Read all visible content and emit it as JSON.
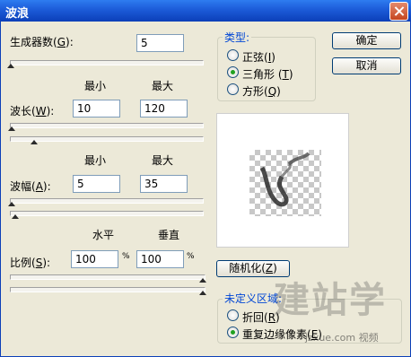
{
  "window": {
    "title": "波浪"
  },
  "generators": {
    "label": "生成器数",
    "hotkey": "G",
    "value": "5"
  },
  "wavelength": {
    "col_min": "最小",
    "col_max": "最大",
    "label": "波长",
    "hotkey": "W",
    "min_value": "10",
    "max_value": "120"
  },
  "amplitude": {
    "col_min": "最小",
    "col_max": "最大",
    "label": "波幅",
    "hotkey": "A",
    "min_value": "5",
    "max_value": "35"
  },
  "scale": {
    "col_h": "水平",
    "col_v": "垂直",
    "label": "比例",
    "hotkey": "S",
    "h_value": "100",
    "v_value": "100",
    "unit": "%"
  },
  "buttons": {
    "ok": "确定",
    "cancel": "取消",
    "randomize": "随机化",
    "randomize_hotkey": "Z"
  },
  "type_group": {
    "legend": "类型:",
    "options": [
      {
        "label": "正弦",
        "hotkey": "I",
        "selected": false
      },
      {
        "label": "三角形",
        "hotkey": "T",
        "selected": true
      },
      {
        "label": "方形",
        "hotkey": "Q",
        "selected": false
      }
    ]
  },
  "undefined_group": {
    "legend": "未定义区域:",
    "options": [
      {
        "label": "折回",
        "hotkey": "R",
        "selected": false
      },
      {
        "label": "重复边缘像素",
        "hotkey": "E",
        "selected": true
      }
    ]
  },
  "watermark": {
    "big": "建站学",
    "small": "jzxue.com 视频"
  },
  "colors": {
    "title_bar": "#1c5bd8",
    "dialog_bg": "#ece9d8",
    "legend_text": "#0046d5"
  }
}
